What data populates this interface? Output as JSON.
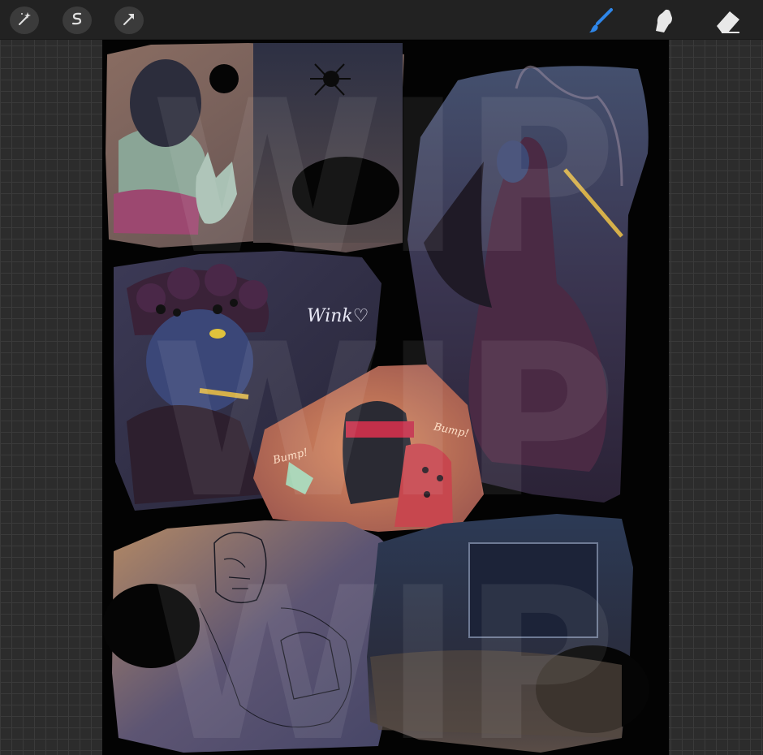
{
  "toolbar": {
    "left_tools": [
      {
        "name": "adjustments",
        "icon": "magic-wand-icon"
      },
      {
        "name": "selection",
        "icon": "selection-s-icon"
      },
      {
        "name": "transform",
        "icon": "arrow-cursor-icon"
      }
    ],
    "right_tools": [
      {
        "name": "brush",
        "icon": "brush-icon",
        "active": true
      },
      {
        "name": "smudge",
        "icon": "smudge-icon",
        "active": false
      },
      {
        "name": "eraser",
        "icon": "eraser-icon",
        "active": false
      }
    ],
    "active_color": "#2f86e8",
    "inactive_color": "#e8e8e8"
  },
  "canvas": {
    "watermark": "WIP",
    "sfx": {
      "wink": "Wink♡",
      "bump_left": "Bump!",
      "bump_right": "Bump!"
    }
  }
}
